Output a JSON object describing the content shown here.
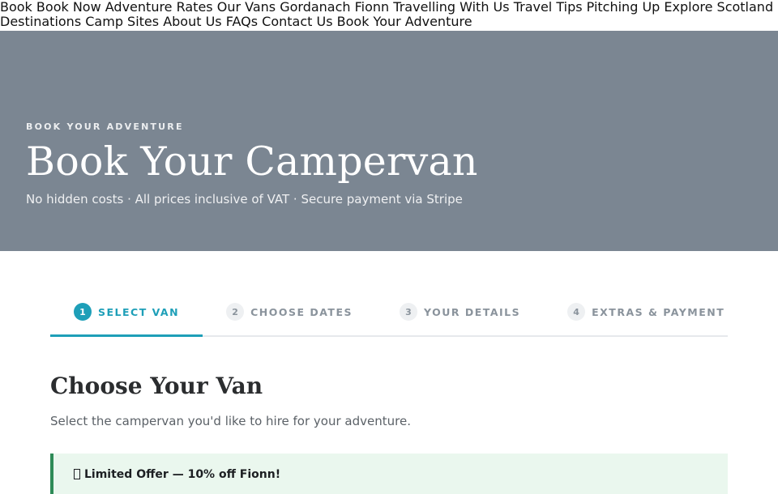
{
  "nav": {
    "links": [
      "Book",
      "Book Now",
      "Adventure Rates",
      "Our Vans",
      "Gordanach",
      "Fionn",
      "Travelling With Us",
      "Travel Tips",
      "Pitching Up",
      "Explore Scotland",
      "Destinations",
      "Camp Sites",
      "About Us",
      "FAQs",
      "Contact Us",
      "Book Your Adventure"
    ]
  },
  "hero": {
    "eyebrow": "BOOK YOUR ADVENTURE",
    "title": "Book Your Campervan",
    "subtitle": "No hidden costs · All prices inclusive of VAT · Secure payment via Stripe",
    "background": "#7b8692"
  },
  "steps": [
    {
      "number": "1",
      "label": "SELECT VAN",
      "active": true
    },
    {
      "number": "2",
      "label": "CHOOSE DATES",
      "active": false
    },
    {
      "number": "3",
      "label": "YOUR DETAILS",
      "active": false
    },
    {
      "number": "4",
      "label": "EXTRAS & PAYMENT",
      "active": false
    }
  ],
  "colors": {
    "accent": "#1e9fb8",
    "offer_bg": "#eaf7ee",
    "offer_border": "#2e8b57"
  },
  "section": {
    "title": "Choose Your Van",
    "subtitle": "Select the campervan you'd like to hire for your adventure."
  },
  "offer": {
    "icon": "gift-icon",
    "title": "Limited Offer — 10% off Fionn!"
  }
}
